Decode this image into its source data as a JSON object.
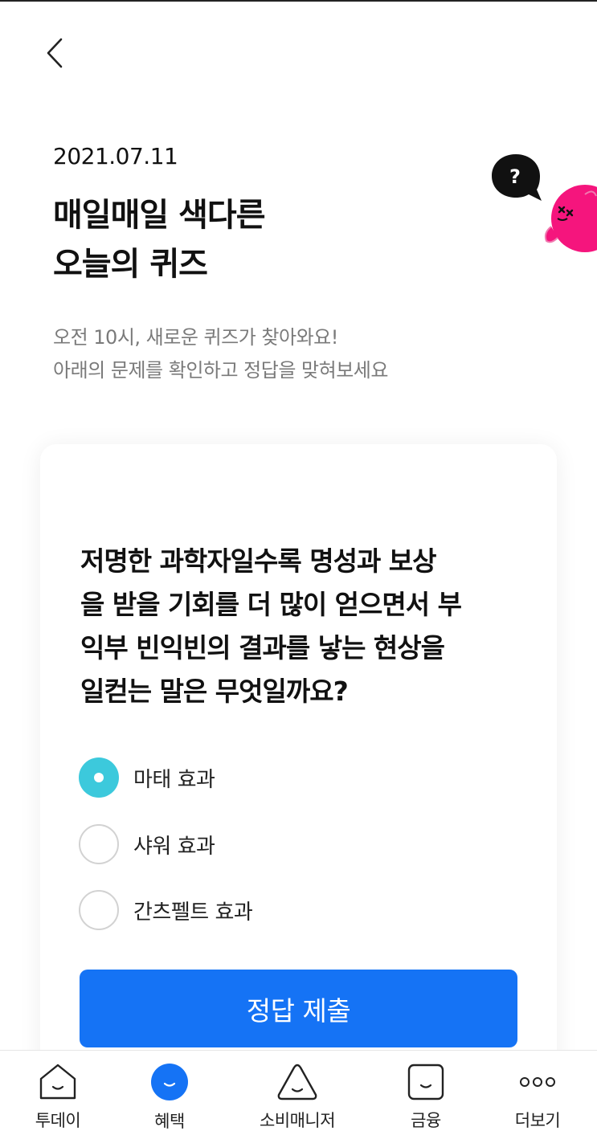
{
  "header": {
    "date": "2021.07.11",
    "title_line1": "매일매일 색다른",
    "title_line2": "오늘의 퀴즈",
    "subtitle_line1": "오전 10시, 새로운 퀴즈가 찾아와요!",
    "subtitle_line2": "아래의 문제를 확인하고 정답을 맞혀보세요",
    "back_icon": "chevron-left-icon"
  },
  "mascot": {
    "bubble_text": "?",
    "bubble_color": "#111111",
    "body_color": "#f5157d"
  },
  "quiz": {
    "question_lines": [
      "저명한 과학자일수록 명성과 보상",
      "을 받을 기회를 더 많이 얻으면서 부",
      "익부 빈익빈의 결과를 낳는 현상을",
      "일컫는 말은 무엇일까요?"
    ],
    "options": [
      {
        "label": "마태 효과",
        "selected": true
      },
      {
        "label": "샤워 효과",
        "selected": false
      },
      {
        "label": "간츠펠트 효과",
        "selected": false
      }
    ],
    "selected_color": "#3cc9dc",
    "submit_label": "정답 제출",
    "submit_color": "#1573f5"
  },
  "tabbar": {
    "tabs": [
      {
        "label": "투데이",
        "icon": "house-face-icon",
        "active": false
      },
      {
        "label": "혜택",
        "icon": "circle-face-icon",
        "active": true
      },
      {
        "label": "소비매니저",
        "icon": "triangle-face-icon",
        "active": false
      },
      {
        "label": "금융",
        "icon": "square-face-icon",
        "active": false
      },
      {
        "label": "더보기",
        "icon": "more-dots-icon",
        "active": false
      }
    ],
    "active_color": "#1573f5"
  }
}
